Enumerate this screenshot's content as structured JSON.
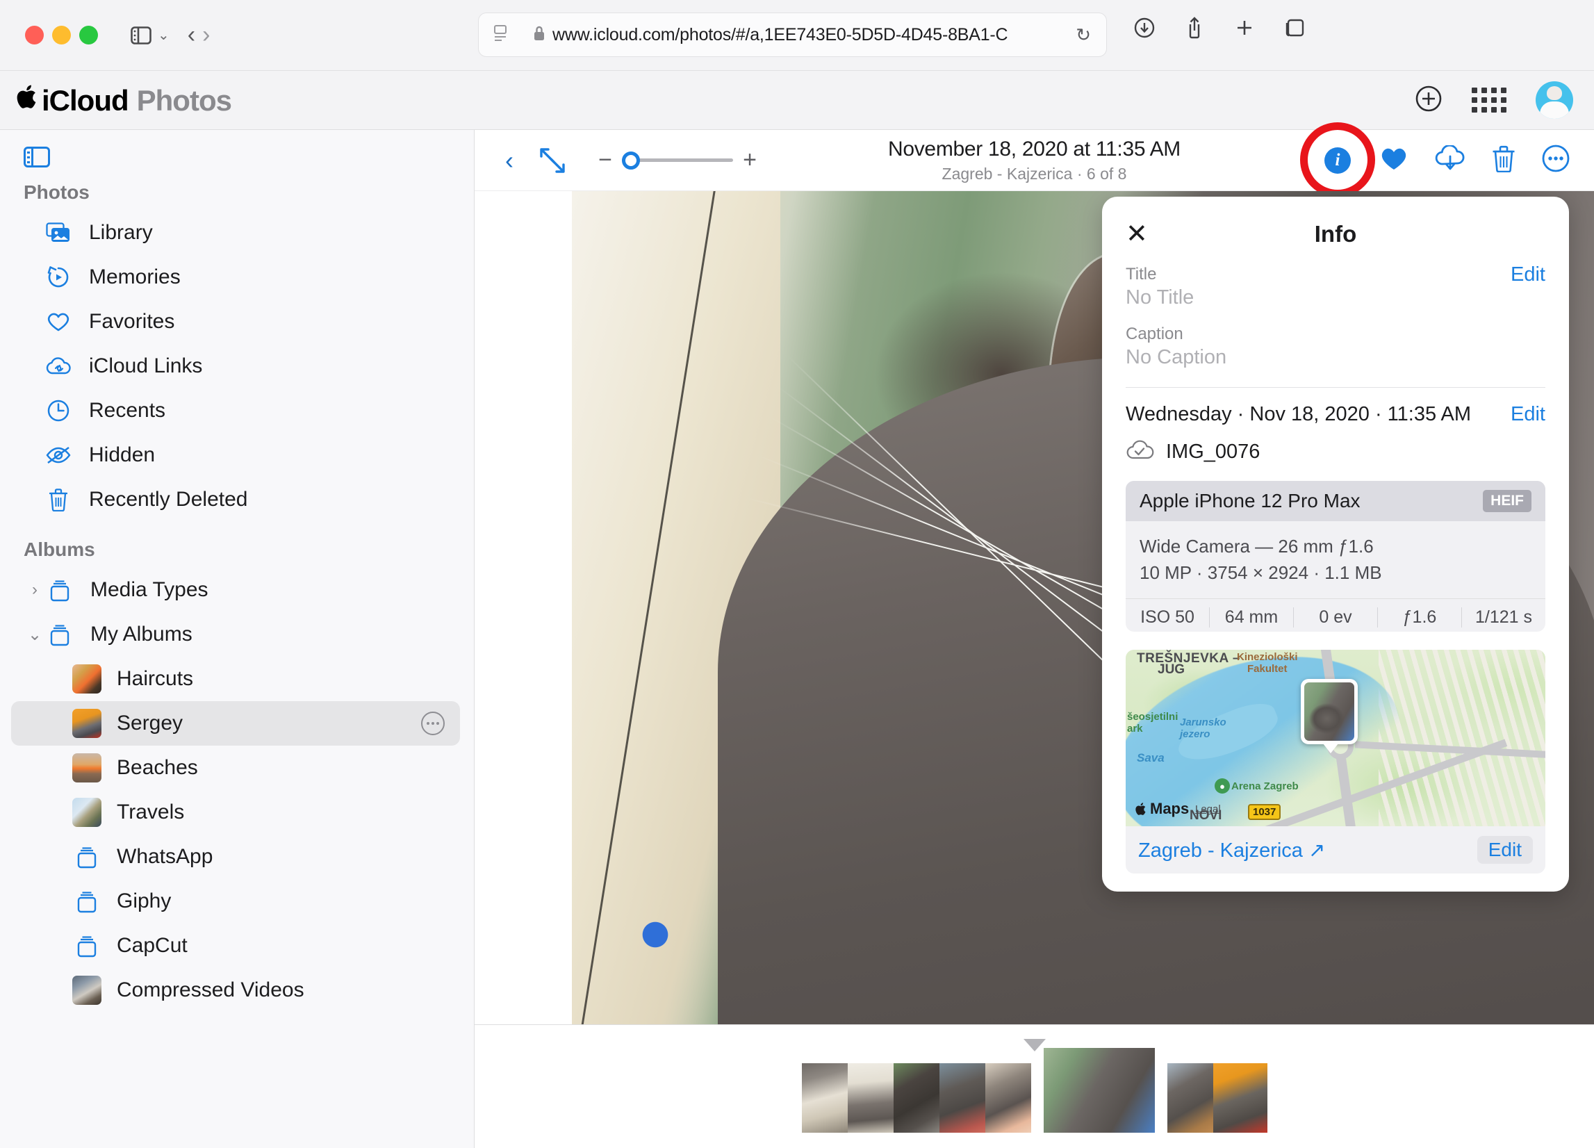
{
  "browser": {
    "url": "www.icloud.com/photos/#/a,1EE743E0-5D5D-4D45-8BA1-C",
    "url_dim_tail": "",
    "back_glyph": "‹",
    "forward_glyph": "›",
    "reload_glyph": "↻",
    "sidebar_chevron": "⌄"
  },
  "header": {
    "apple_logo": "",
    "brand_primary": "iCloud",
    "brand_secondary": "Photos",
    "add_glyph": "+"
  },
  "sidebar": {
    "photos_section_label": "Photos",
    "albums_section_label": "Albums",
    "photos_items": [
      {
        "label": "Library",
        "icon": "library-icon"
      },
      {
        "label": "Memories",
        "icon": "memories-icon"
      },
      {
        "label": "Favorites",
        "icon": "heart-icon"
      },
      {
        "label": "iCloud Links",
        "icon": "cloud-link-icon"
      },
      {
        "label": "Recents",
        "icon": "clock-icon"
      },
      {
        "label": "Hidden",
        "icon": "eye-slash-icon"
      },
      {
        "label": "Recently Deleted",
        "icon": "trash-icon"
      }
    ],
    "groups": [
      {
        "label": "Media Types",
        "expanded": false,
        "chevron": "›"
      },
      {
        "label": "My Albums",
        "expanded": true,
        "chevron": "⌄"
      }
    ],
    "albums": [
      {
        "label": "Haircuts",
        "thumb": "th-haircuts",
        "selected": false
      },
      {
        "label": "Sergey",
        "thumb": "th-sergey",
        "selected": true
      },
      {
        "label": "Beaches",
        "thumb": "th-beaches",
        "selected": false
      },
      {
        "label": "Travels",
        "thumb": "th-travels",
        "selected": false
      },
      {
        "label": "WhatsApp",
        "thumb": "folder",
        "selected": false
      },
      {
        "label": "Giphy",
        "thumb": "folder",
        "selected": false
      },
      {
        "label": "CapCut",
        "thumb": "folder",
        "selected": false
      },
      {
        "label": "Compressed Videos",
        "thumb": "th-compvid",
        "selected": false
      }
    ]
  },
  "viewer": {
    "back_glyph": "‹",
    "zoom_minus": "−",
    "zoom_plus": "+",
    "zoom_value": 0,
    "title": "November 18, 2020 at 11:35 AM",
    "subtitle": "Zagreb - Kajzerica · 6 of 8",
    "position_current": 6,
    "position_total": 8,
    "info_glyph": "i",
    "highlight_color": "#e8151b",
    "accent_color": "#1b7fe0"
  },
  "info_panel": {
    "close_glyph": "✕",
    "title": "Info",
    "title_label": "Title",
    "title_value": "No Title",
    "title_edit": "Edit",
    "caption_label": "Caption",
    "caption_value": "No Caption",
    "date_text": "Wednesday · Nov 18, 2020 · 11:35 AM",
    "date_edit": "Edit",
    "file_name": "IMG_0076",
    "exif": {
      "device": "Apple iPhone 12 Pro Max",
      "format_badge": "HEIF",
      "lens_line": "Wide Camera — 26 mm ƒ1.6",
      "size_line": "10 MP · 3754 × 2924 · 1.1 MB",
      "stats": [
        "ISO 50",
        "64 mm",
        "0 ev",
        "ƒ1.6",
        "1/121 s"
      ]
    },
    "map": {
      "labels": {
        "tresnjevka": "TREŠNJEVKA –",
        "jug": "JUG",
        "kinezioloski": "Kineziološki",
        "fakultet": "Fakultet",
        "park_line1": "šeosjetilni",
        "park_line2": "ark",
        "jarunsko_line1": "Jarunsko",
        "jarunsko_line2": "jezero",
        "sava": "Sava",
        "arena": "Arena Zagreb",
        "novi": "NOVI",
        "route_shield": "1037",
        "maps_logo": "Maps",
        "apple_glyph": "",
        "legal": "Legal"
      },
      "place_name": "Zagreb - Kajzerica ↗",
      "edit_label": "Edit"
    }
  },
  "filmstrip": {
    "caret": "▼",
    "thumbs": [
      {
        "cls": "t1",
        "current": false
      },
      {
        "cls": "t2",
        "current": false
      },
      {
        "cls": "t3",
        "current": false
      },
      {
        "cls": "t4",
        "current": false
      },
      {
        "cls": "t5",
        "current": false
      },
      {
        "cls": "tcur",
        "current": true
      },
      {
        "cls": "t7",
        "current": false
      },
      {
        "cls": "t8",
        "current": false
      }
    ]
  }
}
